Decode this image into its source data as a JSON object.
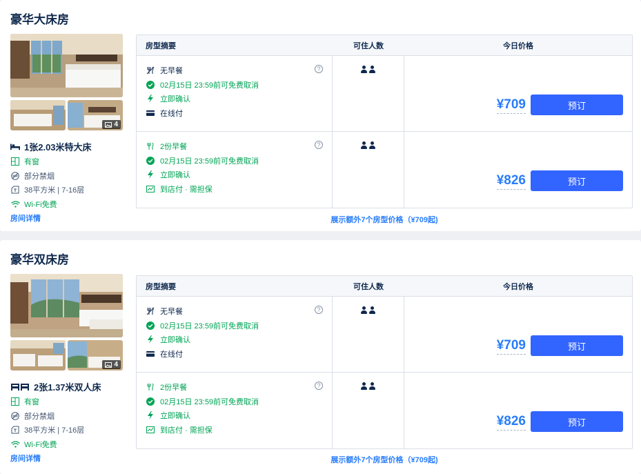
{
  "rooms": [
    {
      "title": "豪华大床房",
      "photo_count": "4",
      "bed": "1张2.03米特大床",
      "bed_icon": "single-bed-icon",
      "window": "有窗",
      "smoking": "部分禁烟",
      "area_floor": "38平方米 | 7-16层",
      "wifi": "Wi-Fi免费",
      "detail_link": "房间详情",
      "more_link": "展示额外7个房型价格（¥709起)",
      "header": {
        "summary": "房型摘要",
        "occupancy": "可住人数",
        "price": "今日价格"
      },
      "rates": [
        {
          "meal": "无早餐",
          "meal_icon": "no-breakfast-icon",
          "cancel": "02月15日 23:59前可免费取消",
          "confirm": "立即确认",
          "payment": "在线付",
          "payment_icon": "card-icon",
          "price": "¥709",
          "book": "预订"
        },
        {
          "meal": "2份早餐",
          "meal_icon": "breakfast-icon",
          "cancel": "02月15日 23:59前可免费取消",
          "confirm": "立即确认",
          "payment": "到店付 · 需担保",
          "payment_icon": "pay-at-hotel-icon",
          "price": "¥826",
          "book": "预订"
        }
      ]
    },
    {
      "title": "豪华双床房",
      "photo_count": "4",
      "bed": "2张1.37米双人床",
      "bed_icon": "twin-bed-icon",
      "window": "有窗",
      "smoking": "部分禁烟",
      "area_floor": "38平方米 | 7-16层",
      "wifi": "Wi-Fi免费",
      "detail_link": "房间详情",
      "more_link": "展示额外7个房型价格（¥709起)",
      "header": {
        "summary": "房型摘要",
        "occupancy": "可住人数",
        "price": "今日价格"
      },
      "rates": [
        {
          "meal": "无早餐",
          "meal_icon": "no-breakfast-icon",
          "cancel": "02月15日 23:59前可免费取消",
          "confirm": "立即确认",
          "payment": "在线付",
          "payment_icon": "card-icon",
          "price": "¥709",
          "book": "预订"
        },
        {
          "meal": "2份早餐",
          "meal_icon": "breakfast-icon",
          "cancel": "02月15日 23:59前可免费取消",
          "confirm": "立即确认",
          "payment": "到店付 · 需担保",
          "payment_icon": "pay-at-hotel-icon",
          "price": "¥826",
          "book": "预订"
        }
      ]
    }
  ],
  "colors": {
    "accent": "#287dfa",
    "book_button": "#3264ff",
    "green": "#00a455",
    "text": "#0f294d"
  }
}
